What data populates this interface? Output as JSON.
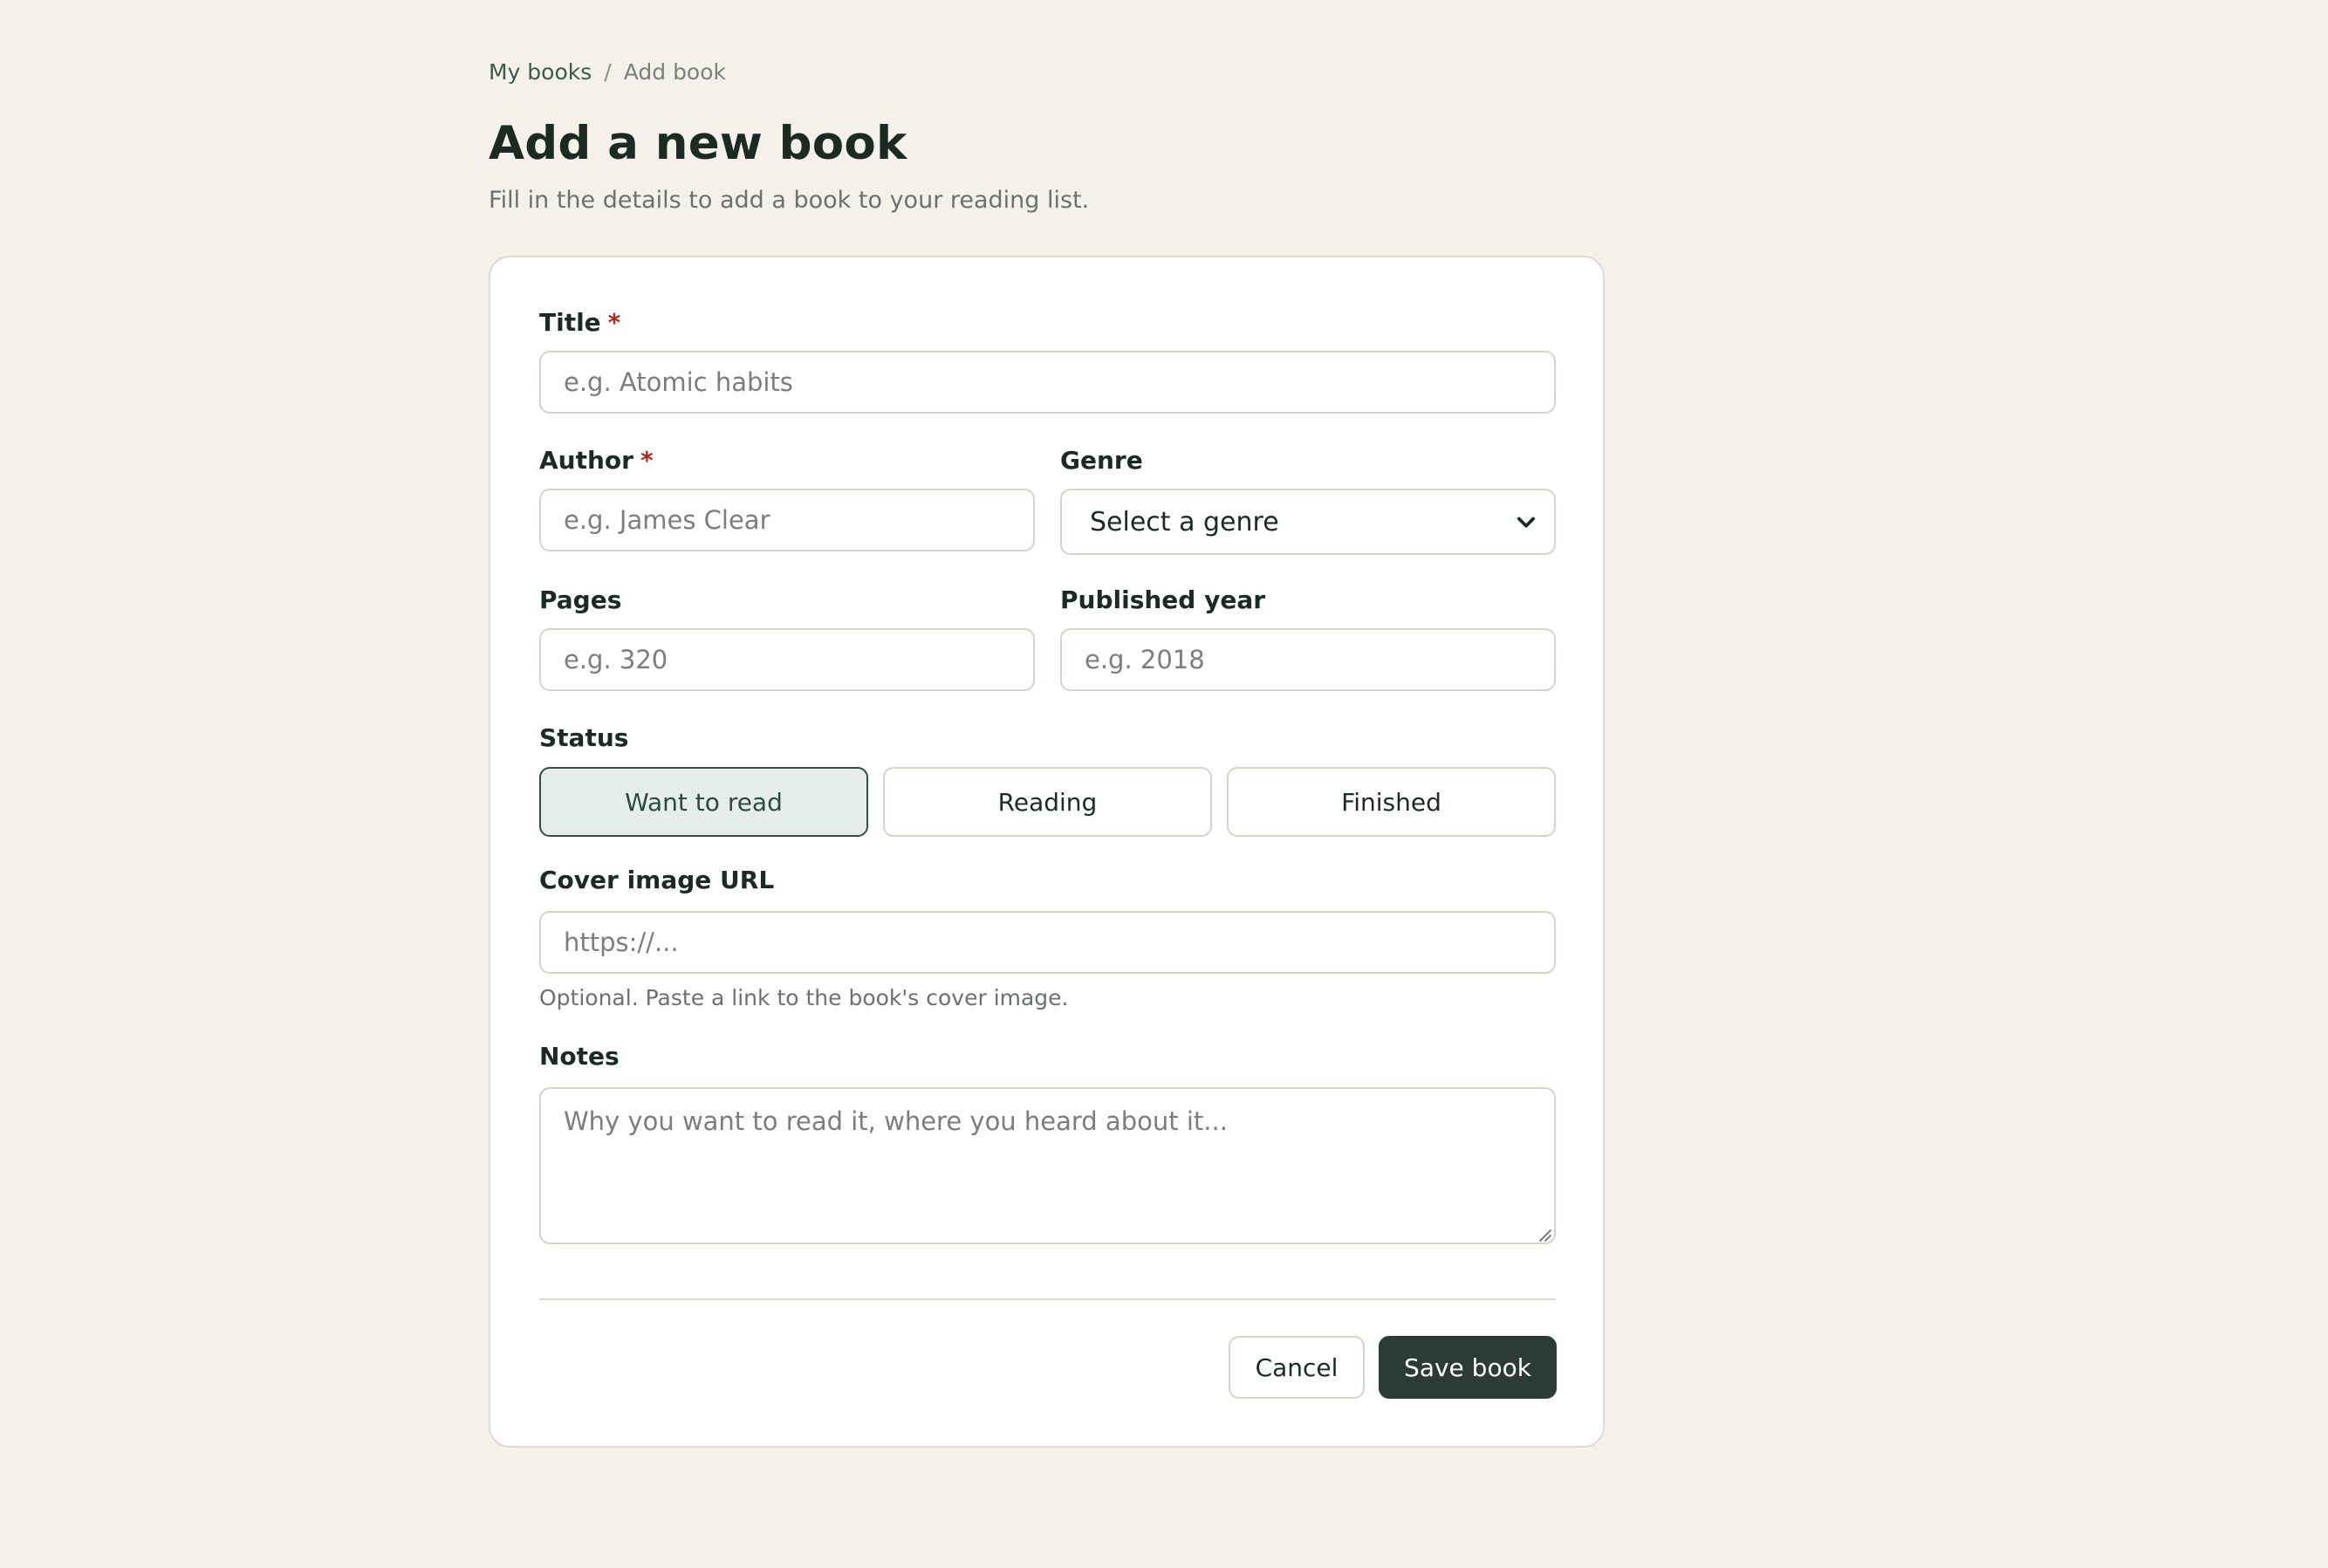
{
  "breadcrumb": {
    "parent": "My books",
    "separator": "/",
    "current": "Add book"
  },
  "header": {
    "title": "Add a new book",
    "subtitle": "Fill in the details to add a book to your reading list."
  },
  "form": {
    "title": {
      "label": "Title",
      "required_mark": "*",
      "placeholder": "e.g. Atomic habits",
      "value": ""
    },
    "author": {
      "label": "Author",
      "required_mark": "*",
      "placeholder": "e.g. James Clear",
      "value": ""
    },
    "genre": {
      "label": "Genre",
      "selected": "Select a genre"
    },
    "pages": {
      "label": "Pages",
      "placeholder": "e.g. 320",
      "value": ""
    },
    "published_year": {
      "label": "Published year",
      "placeholder": "e.g. 2018",
      "value": ""
    },
    "status": {
      "label": "Status",
      "options": [
        "Want to read",
        "Reading",
        "Finished"
      ],
      "selected": "Want to read"
    },
    "cover_url": {
      "label": "Cover image URL",
      "placeholder": "https://...",
      "hint": "Optional. Paste a link to the book's cover image.",
      "value": ""
    },
    "notes": {
      "label": "Notes",
      "placeholder": "Why you want to read it, where you heard about it...",
      "value": ""
    }
  },
  "actions": {
    "cancel_label": "Cancel",
    "save_label": "Save book"
  },
  "colors": {
    "background": "#f4f1ea",
    "primary": "#2c3b33",
    "selected_status_bg": "#e6eee9",
    "required": "#b3261e"
  }
}
